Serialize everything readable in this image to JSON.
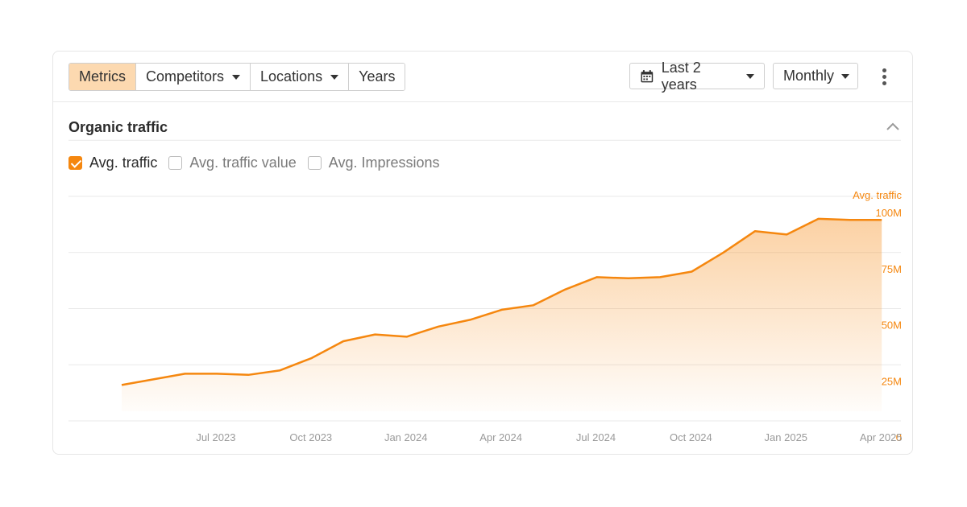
{
  "toolbar": {
    "tabs": [
      {
        "label": "Metrics",
        "active": true
      },
      {
        "label": "Competitors",
        "dropdown": true
      },
      {
        "label": "Locations",
        "dropdown": true
      },
      {
        "label": "Years"
      }
    ],
    "date_range": "Last 2 years",
    "interval": "Monthly"
  },
  "section": {
    "title": "Organic traffic"
  },
  "metrics": [
    {
      "label": "Avg. traffic",
      "checked": true
    },
    {
      "label": "Avg. traffic value",
      "checked": false
    },
    {
      "label": "Avg. Impressions",
      "checked": false
    }
  ],
  "colors": {
    "accent": "#f5870f",
    "active_tab_bg": "#fcd9b0",
    "axis_label": "#f5870f",
    "tick_label": "#9a9a9a",
    "grid": "#e9e9e9"
  },
  "chart_data": {
    "type": "area",
    "y_axis_title": "Avg. traffic",
    "x_tick_labels": [
      "Jul 2023",
      "Oct 2023",
      "Jan 2024",
      "Apr 2024",
      "Jul 2024",
      "Oct 2024",
      "Jan 2025",
      "Apr 2025"
    ],
    "y_tick_labels": [
      "0",
      "25M",
      "50M",
      "75M",
      "100M"
    ],
    "ylim": [
      0,
      100000000
    ],
    "grid": true,
    "series": [
      {
        "name": "Avg. traffic",
        "x": [
          "2023-04",
          "2023-05",
          "2023-06",
          "2023-07",
          "2023-08",
          "2023-09",
          "2023-10",
          "2023-11",
          "2023-12",
          "2024-01",
          "2024-02",
          "2024-03",
          "2024-04",
          "2024-05",
          "2024-06",
          "2024-07",
          "2024-08",
          "2024-09",
          "2024-10",
          "2024-11",
          "2024-12",
          "2025-01",
          "2025-02",
          "2025-03",
          "2025-04"
        ],
        "values": [
          16000000,
          18500000,
          21000000,
          21000000,
          20500000,
          22500000,
          28000000,
          35500000,
          38500000,
          37500000,
          42000000,
          45000000,
          49500000,
          51500000,
          58500000,
          64000000,
          63500000,
          64000000,
          66500000,
          75000000,
          84500000,
          83000000,
          90000000,
          89500000,
          89500000
        ]
      }
    ]
  }
}
